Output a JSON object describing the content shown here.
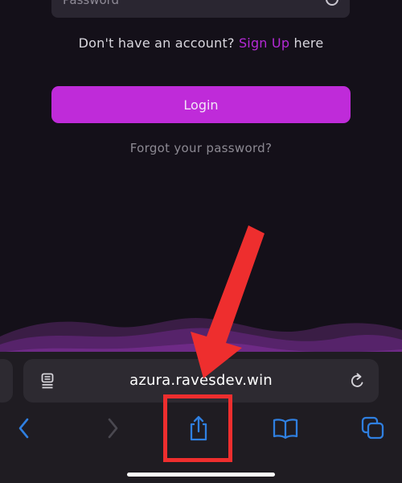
{
  "login_form": {
    "password_placeholder": "Password",
    "signup_prompt": "Don't have an account?",
    "signup_link": "Sign Up",
    "signup_suffix": "here",
    "login_label": "Login",
    "forgot_label": "Forgot your password?"
  },
  "browser": {
    "url": "azura.ravesdev.win",
    "toolbar_icons": [
      "back-icon",
      "forward-icon",
      "share-icon",
      "bookmarks-icon",
      "tabs-icon"
    ]
  },
  "annotation": {
    "arrow_color": "#ee2e2e",
    "highlight_target": "share-icon"
  },
  "colors": {
    "accent": "#bf2bd9",
    "link": "#b52ad6",
    "background": "#141019",
    "toolbar_icon": "#2f7fe0"
  }
}
